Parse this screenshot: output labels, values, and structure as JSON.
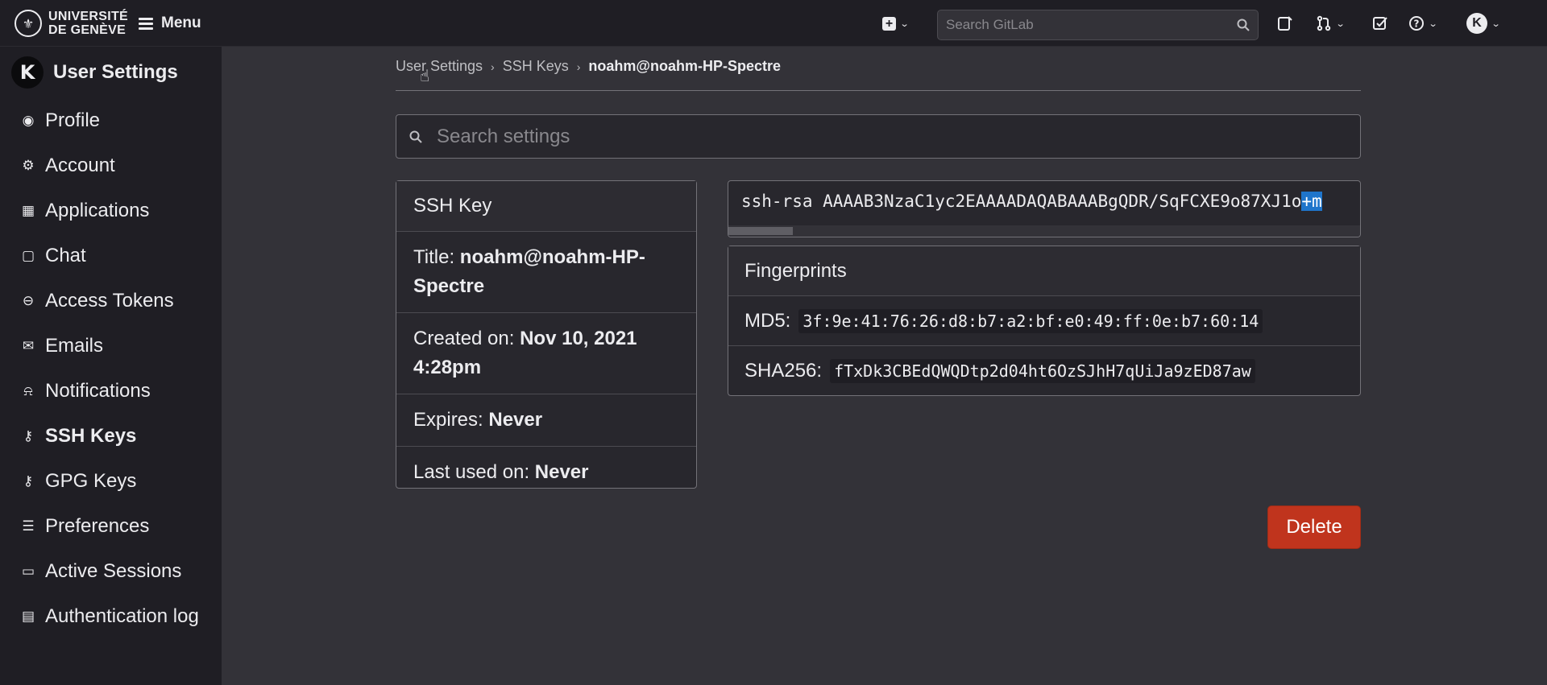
{
  "brand": {
    "line1": "UNIVERSITÉ",
    "line2": "DE GENÈVE"
  },
  "topbar": {
    "menu_label": "Menu",
    "search_placeholder": "Search GitLab",
    "avatar_letter": "K"
  },
  "sidebar": {
    "avatar_letter": "K",
    "title": "User Settings",
    "items": [
      {
        "label": "Profile",
        "icon": "profile-icon"
      },
      {
        "label": "Account",
        "icon": "account-icon"
      },
      {
        "label": "Applications",
        "icon": "applications-icon"
      },
      {
        "label": "Chat",
        "icon": "chat-icon"
      },
      {
        "label": "Access Tokens",
        "icon": "token-icon"
      },
      {
        "label": "Emails",
        "icon": "mail-icon"
      },
      {
        "label": "Notifications",
        "icon": "bell-icon"
      },
      {
        "label": "SSH Keys",
        "icon": "key-icon",
        "active": true
      },
      {
        "label": "GPG Keys",
        "icon": "key-icon"
      },
      {
        "label": "Preferences",
        "icon": "preferences-icon"
      },
      {
        "label": "Active Sessions",
        "icon": "monitor-icon"
      },
      {
        "label": "Authentication log",
        "icon": "log-icon"
      }
    ]
  },
  "breadcrumb": {
    "items": [
      "User Settings",
      "SSH Keys"
    ],
    "current": "noahm@noahm-HP-Spectre"
  },
  "settings_search": {
    "placeholder": "Search settings"
  },
  "ssh_card": {
    "header": "SSH Key",
    "title_label": "Title:",
    "title_value": "noahm@noahm-HP-Spectre",
    "created_label": "Created on:",
    "created_value": "Nov 10, 2021 4:28pm",
    "expires_label": "Expires:",
    "expires_value": "Never",
    "last_used_label": "Last used on:",
    "last_used_value": "Never"
  },
  "key": {
    "text": "ssh-rsa AAAAB3NzaC1yc2EAAAADAQABAAABgQDR/SqFCXE9o87XJ1o",
    "selected": "+m"
  },
  "fingerprints": {
    "header": "Fingerprints",
    "md5_label": "MD5:",
    "md5_value": "3f:9e:41:76:26:d8:b7:a2:bf:e0:49:ff:0e:b7:60:14",
    "sha256_label": "SHA256:",
    "sha256_value": "fTxDk3CBEdQWQDtp2d04ht6OzSJhH7qUiJa9zED87aw"
  },
  "actions": {
    "delete_label": "Delete"
  },
  "colors": {
    "danger": "#c0341d",
    "selection": "#1f75cb",
    "bg": "#333238",
    "sidebar_bg": "#1f1e24"
  }
}
